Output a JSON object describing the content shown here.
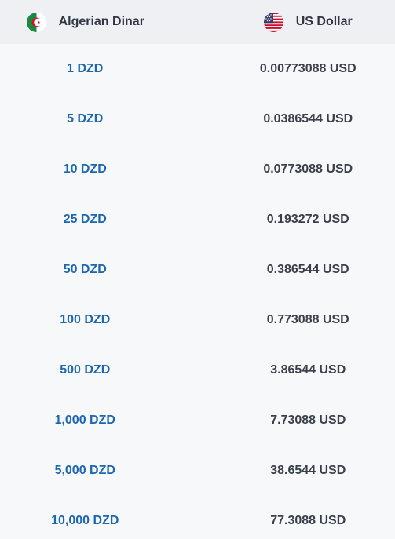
{
  "header": {
    "from_currency": "Algerian Dinar",
    "to_currency": "US Dollar"
  },
  "rows": [
    {
      "from": "1 DZD",
      "to": "0.00773088 USD"
    },
    {
      "from": "5 DZD",
      "to": "0.0386544 USD"
    },
    {
      "from": "10 DZD",
      "to": "0.0773088 USD"
    },
    {
      "from": "25 DZD",
      "to": "0.193272 USD"
    },
    {
      "from": "50 DZD",
      "to": "0.386544 USD"
    },
    {
      "from": "100 DZD",
      "to": "0.773088 USD"
    },
    {
      "from": "500 DZD",
      "to": "3.86544 USD"
    },
    {
      "from": "1,000 DZD",
      "to": "7.73088 USD"
    },
    {
      "from": "5,000 DZD",
      "to": "38.6544 USD"
    },
    {
      "from": "10,000 DZD",
      "to": "77.3088 USD"
    }
  ],
  "colors": {
    "link": "#1d66b0",
    "value": "#3a404b",
    "header_bg": "#eef0f3",
    "body_bg": "#f7f8fa"
  }
}
